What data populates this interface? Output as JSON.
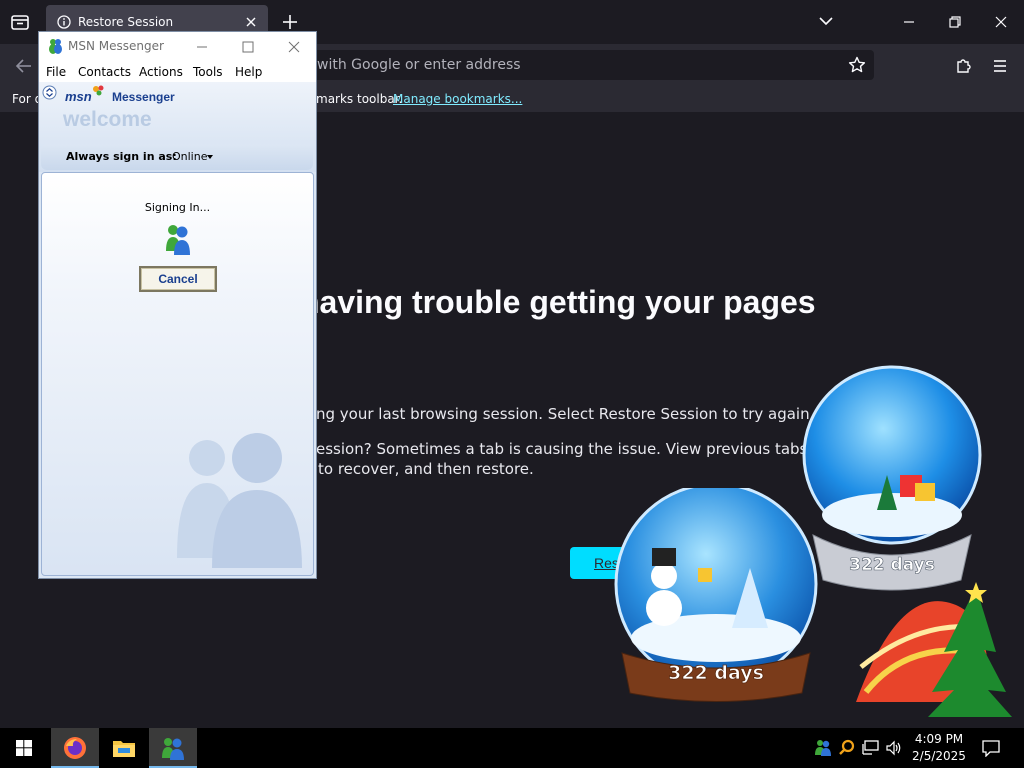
{
  "browser": {
    "tab_title": "Restore Session",
    "url_placeholder": "with Google or enter address",
    "bookmarks_prefix": "For q",
    "bookmarks_suffix": "marks toolbar.",
    "manage_bookmarks": "Manage bookmarks..."
  },
  "page": {
    "headline": "having trouble getting your pages",
    "para1": "ng your last browsing session. Select Restore Session to try again.",
    "para2_line1": "ession? Sometimes a tab is causing the issue. View previous tabs, remove",
    "para2_line2": "to recover, and then restore.",
    "restore_button": "Res"
  },
  "globes": {
    "left_label": "322 days",
    "right_label": "322 days"
  },
  "msn": {
    "window_title": "MSN Messenger",
    "menu": [
      "File",
      "Contacts",
      "Actions",
      "Tools",
      "Help"
    ],
    "brand_msn": "msn",
    "brand_messenger": "Messenger",
    "welcome": "welcome",
    "status_label": "Always sign in as:",
    "status_value": "Online",
    "signing_in": "Signing In...",
    "cancel": "Cancel"
  },
  "taskbar": {
    "time": "4:09 PM",
    "date": "2/5/2025"
  },
  "icons": [
    "list-tabs-icon",
    "info-icon",
    "close-icon",
    "plus-icon",
    "chevron-down-icon",
    "minimize-icon",
    "maximize-icon",
    "back-icon",
    "star-icon",
    "extensions-icon",
    "menu-icon",
    "msn-butterfly-icon",
    "buddy-icon",
    "windows-start-icon",
    "firefox-icon",
    "file-explorer-icon",
    "msn-taskbar-icon",
    "search-icon",
    "network-icon",
    "volume-icon",
    "notifications-icon"
  ],
  "colors": {
    "accent": "#00ddff",
    "msn_blue": "#1a3f8f",
    "link": "#80ebff"
  }
}
